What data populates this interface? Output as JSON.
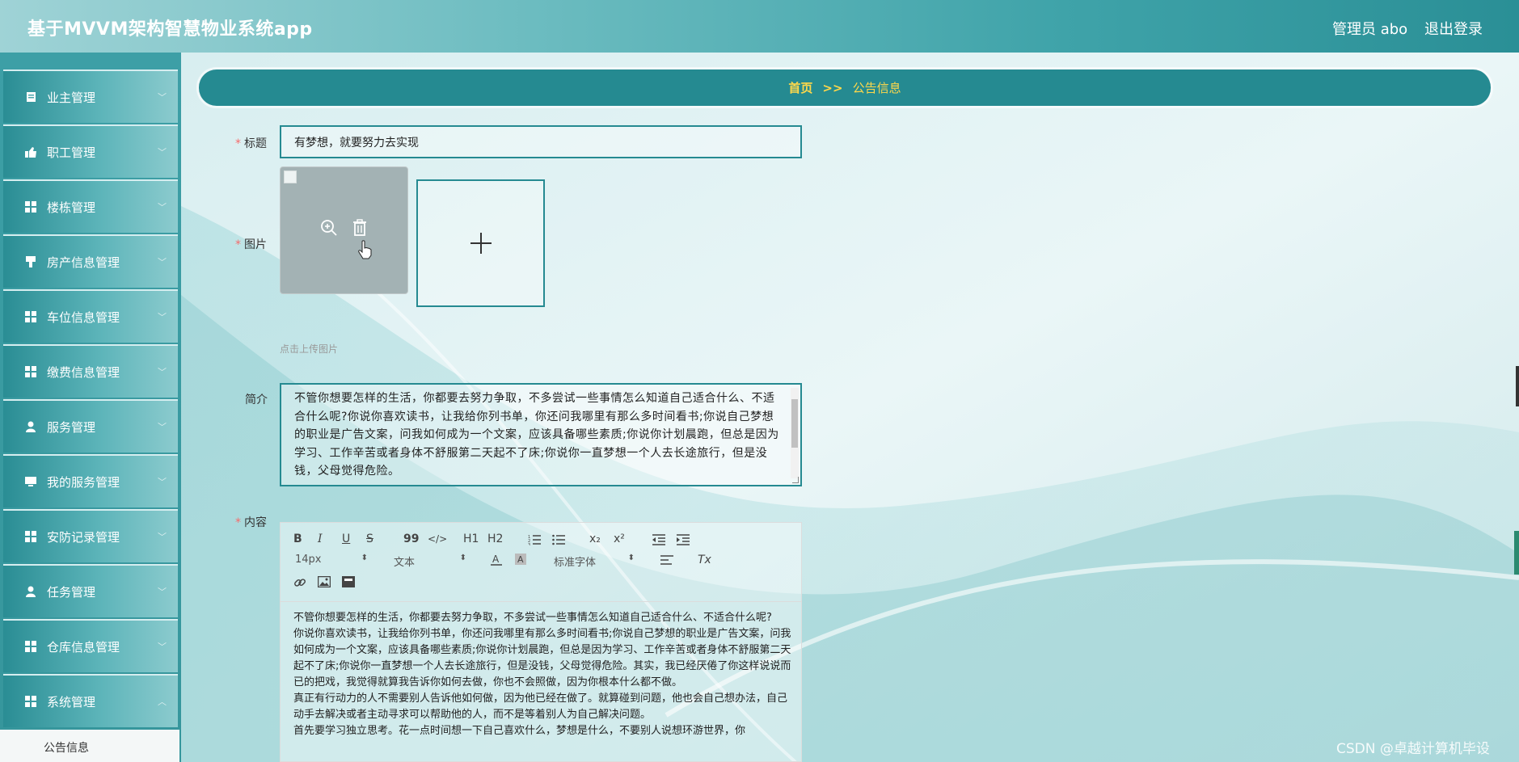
{
  "header": {
    "app_title": "基于MVVM架构智慧物业系统app",
    "admin_text": "管理员 abo",
    "logout_label": "退出登录"
  },
  "sidebar": {
    "items": [
      {
        "label": "业主管理",
        "icon": "clipboard-icon"
      },
      {
        "label": "职工管理",
        "icon": "thumb-icon"
      },
      {
        "label": "楼栋管理",
        "icon": "grid-icon"
      },
      {
        "label": "房产信息管理",
        "icon": "chair-icon"
      },
      {
        "label": "车位信息管理",
        "icon": "grid-icon"
      },
      {
        "label": "缴费信息管理",
        "icon": "grid-icon"
      },
      {
        "label": "服务管理",
        "icon": "user-icon"
      },
      {
        "label": "我的服务管理",
        "icon": "monitor-icon"
      },
      {
        "label": "安防记录管理",
        "icon": "grid-icon"
      },
      {
        "label": "任务管理",
        "icon": "user-icon"
      },
      {
        "label": "仓库信息管理",
        "icon": "grid-icon"
      },
      {
        "label": "系统管理",
        "icon": "grid-icon"
      }
    ],
    "sub_item_label": "公告信息"
  },
  "breadcrumb": {
    "home": "首页",
    "separator": ">>",
    "current": "公告信息"
  },
  "form": {
    "title_label": "标题",
    "title_value": "有梦想，就要努力去实现",
    "image_label": "图片",
    "upload_hint": "点击上传图片",
    "intro_label": "简介",
    "intro_text": "不管你想要怎样的生活，你都要去努力争取，不多尝试一些事情怎么知道自己适合什么、不适合什么呢?你说你喜欢读书，让我给你列书单，你还问我哪里有那么多时间看书;你说自己梦想的职业是广告文案，问我如何成为一个文案，应该具备哪些素质;你说你计划晨跑，但总是因为学习、工作辛苦或者身体不舒服第二天起不了床;你说你一直梦想一个人去长途旅行，但是没钱，父母觉得危险。",
    "content_label": "内容",
    "content_paragraphs": [
      "不管你想要怎样的生活，你都要去努力争取，不多尝试一些事情怎么知道自己适合什么、不适合什么呢?",
      "你说你喜欢读书，让我给你列书单，你还问我哪里有那么多时间看书;你说自己梦想的职业是广告文案，问我如何成为一个文案，应该具备哪些素质;你说你计划晨跑，但总是因为学习、工作辛苦或者身体不舒服第二天起不了床;你说你一直梦想一个人去长途旅行，但是没钱，父母觉得危险。其实，我已经厌倦了你这样说说而已的把戏，我觉得就算我告诉你如何去做，你也不会照做，因为你根本什么都不做。",
      "真正有行动力的人不需要别人告诉他如何做，因为他已经在做了。就算碰到问题，他也会自己想办法，自己动手去解决或者主动寻求可以帮助他的人，而不是等着别人为自己解决问题。",
      "首先要学习独立思考。花一点时间想一下自己喜欢什么，梦想是什么，不要别人说想环游世界，你"
    ]
  },
  "editor_toolbar": {
    "font_size": "14px",
    "paragraph": "文本",
    "font_family": "标准字体",
    "h1": "H1",
    "h2": "H2",
    "bold": "B",
    "italic": "I",
    "underline": "U",
    "strike": "S",
    "quote": "99",
    "code": "</>",
    "sub": "x₂",
    "sup": "x²",
    "clear": "Tx"
  },
  "watermark": "CSDN @卓越计算机毕设",
  "colors": {
    "primary": "#258a91",
    "breadcrumb_text": "#ffd84a",
    "required": "#f56c6c"
  }
}
